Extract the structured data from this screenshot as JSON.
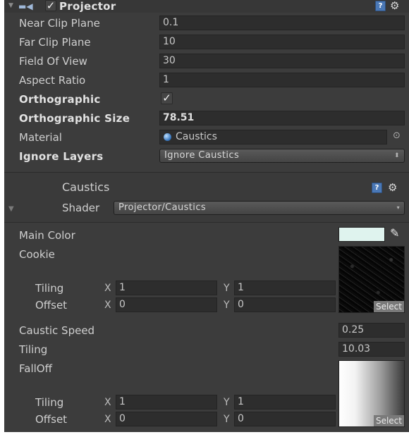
{
  "projector": {
    "title": "Projector",
    "enabled": true,
    "fields": {
      "near_clip": {
        "label": "Near Clip Plane",
        "value": "0.1"
      },
      "far_clip": {
        "label": "Far Clip Plane",
        "value": "10"
      },
      "fov": {
        "label": "Field Of View",
        "value": "30"
      },
      "aspect": {
        "label": "Aspect Ratio",
        "value": "1"
      },
      "ortho": {
        "label": "Orthographic",
        "checked": true
      },
      "ortho_size": {
        "label": "Orthographic Size",
        "value": "78.51"
      },
      "material": {
        "label": "Material",
        "value": "Caustics"
      },
      "ignore_layers": {
        "label": "Ignore Layers",
        "value": "Ignore Caustics"
      }
    }
  },
  "material": {
    "title": "Caustics",
    "shader_label": "Shader",
    "shader_value": "Projector/Caustics",
    "main_color_label": "Main Color",
    "main_color": "#dff3ee",
    "cookie": {
      "label": "Cookie",
      "tiling_label": "Tiling",
      "offset_label": "Offset",
      "tiling_x": "1",
      "tiling_y": "1",
      "offset_x": "0",
      "offset_y": "0",
      "select_label": "Select"
    },
    "caustic_speed": {
      "label": "Caustic Speed",
      "value": "0.25"
    },
    "tiling": {
      "label": "Tiling",
      "value": "10.03"
    },
    "falloff": {
      "label": "FallOff",
      "tiling_label": "Tiling",
      "offset_label": "Offset",
      "tiling_x": "1",
      "tiling_y": "1",
      "offset_x": "0",
      "offset_y": "0",
      "select_label": "Select"
    },
    "axis_x": "X",
    "axis_y": "Y"
  },
  "icons": {
    "help": "?",
    "gear": "⚙",
    "check": "✓",
    "pencil": "✎",
    "fold_open": "▼",
    "dropdown_arrow": "⬍",
    "target": "⊙"
  }
}
